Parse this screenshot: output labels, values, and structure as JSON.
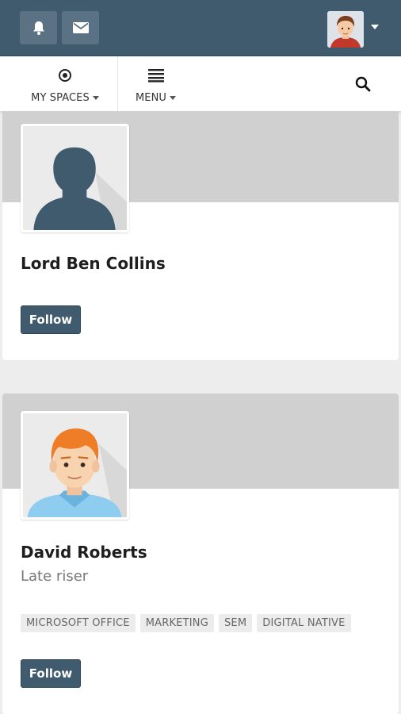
{
  "header": {
    "notifications_icon": "bell-icon",
    "messages_icon": "envelope-icon"
  },
  "nav": {
    "my_spaces_label": "MY SPACES",
    "menu_label": "MENU"
  },
  "people": [
    {
      "name": "Lord Ben Collins",
      "tagline": "",
      "tags": [],
      "follow_label": "Follow"
    },
    {
      "name": "David Roberts",
      "tagline": "Late riser",
      "tags": [
        "MICROSOFT OFFICE",
        "MARKETING",
        "SEM",
        "DIGITAL NATIVE"
      ],
      "follow_label": "Follow"
    }
  ],
  "colors": {
    "header_bg": "#415b6e",
    "button_bg": "#415b6e",
    "banner": "#d0d0d0",
    "page_bg": "#ededed"
  }
}
